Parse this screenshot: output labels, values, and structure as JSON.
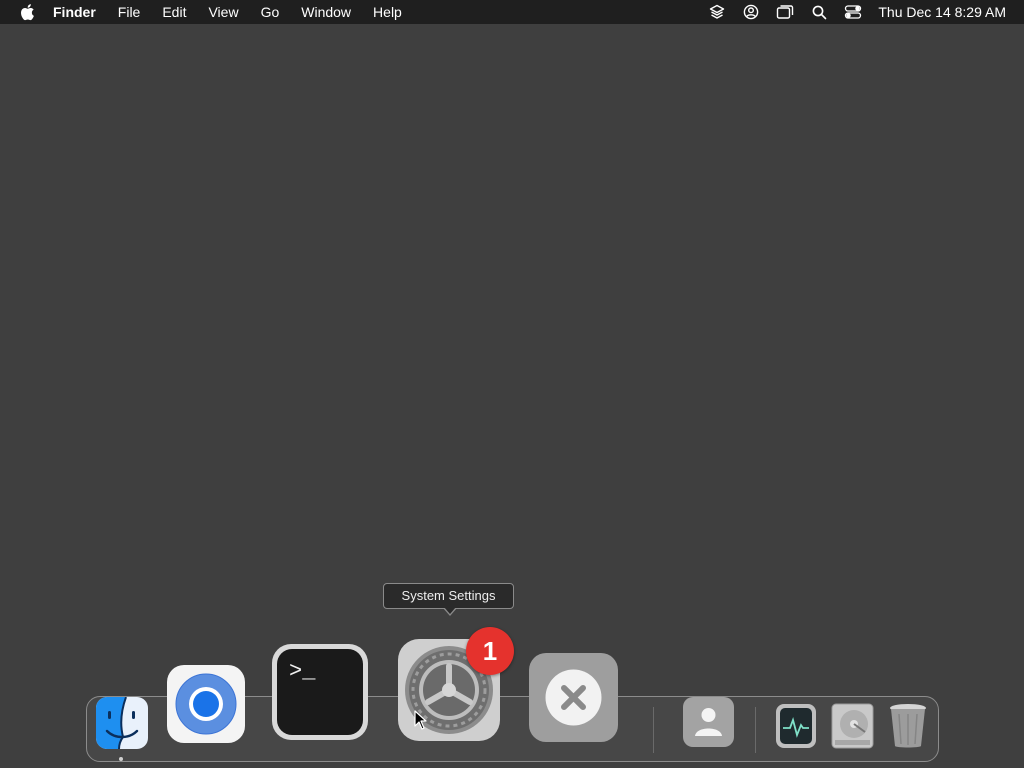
{
  "menubar": {
    "app_name": "Finder",
    "items": [
      "File",
      "Edit",
      "View",
      "Go",
      "Window",
      "Help"
    ],
    "status_icons": [
      "layers-icon",
      "user-account-icon",
      "screen-mirroring-icon",
      "spotlight-search-icon",
      "control-center-icon"
    ],
    "clock": "Thu Dec 14  8:29 AM"
  },
  "tooltip": {
    "text": "System Settings"
  },
  "dock": {
    "apps": [
      {
        "name": "Finder",
        "icon": "finder-icon",
        "running": true
      },
      {
        "name": "Google Chrome",
        "icon": "chrome-icon",
        "running": false
      },
      {
        "name": "Terminal",
        "icon": "terminal-icon",
        "running": false
      },
      {
        "name": "System Settings",
        "icon": "system-settings-icon",
        "running": false,
        "badge": "1"
      },
      {
        "name": "Close",
        "icon": "close-x-icon",
        "running": false
      }
    ],
    "others": [
      {
        "name": "Contacts",
        "icon": "contacts-icon"
      },
      {
        "name": "Activity Monitor",
        "icon": "activity-monitor-icon"
      },
      {
        "name": "Disk Utility",
        "icon": "disk-utility-icon"
      },
      {
        "name": "Trash",
        "icon": "trash-icon"
      }
    ],
    "terminal_prompt": ">_"
  },
  "colors": {
    "desktop": "#3f3f3f",
    "menubar": "#1f1f1f",
    "badge": "#e5322d",
    "chrome_blue": "#1a73e8"
  }
}
